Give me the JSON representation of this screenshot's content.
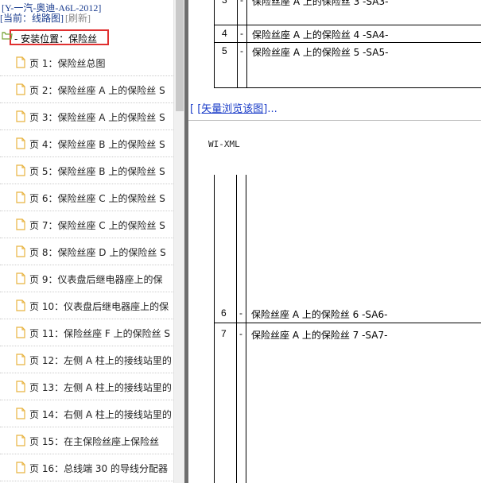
{
  "tree": {
    "vehicle_title": "[Y-一汽-奥迪-A6L-2012]",
    "breadcrumb_current": "[当前：线路图]",
    "breadcrumb_refresh": "[刷新]",
    "folder_label": "- 安装位置：保险丝",
    "items": [
      "页 1：保险丝总图",
      "页 2：保险丝座 A 上的保险丝 S",
      "页 3：保险丝座 A 上的保险丝 S",
      "页 4：保险丝座 B 上的保险丝 S",
      "页 5：保险丝座 B 上的保险丝 S",
      "页 6：保险丝座 C 上的保险丝 S",
      "页 7：保险丝座 C 上的保险丝 S",
      "页 8：保险丝座 D 上的保险丝 S",
      "页 9：仪表盘后继电器座上的保",
      "页 10：仪表盘后继电器座上的保",
      "页 11：保险丝座 F 上的保险丝 S",
      "页 12：左侧 A 柱上的接线站里的",
      "页 13：左侧 A 柱上的接线站里的",
      "页 14：右侧 A 柱上的接线站里的",
      "页 15：在主保险丝座上保险丝",
      "页 16：总线端 30 的导线分配器"
    ]
  },
  "doc": {
    "top_rows": [
      {
        "num": "3",
        "dash": "-",
        "desc": "保险丝座 A 上的保险丝 3 -SA3-"
      },
      {
        "num": "4",
        "dash": "-",
        "desc": "保险丝座 A 上的保险丝 4 -SA4-"
      },
      {
        "num": "5",
        "dash": "-",
        "desc": "保险丝座 A 上的保险丝 5 -SA5-"
      }
    ],
    "vector_link_open": "[",
    "vector_link": "[矢量浏览该图]",
    "vector_link_close": "...",
    "wi_label": "WI-XML",
    "bottom_rows": [
      {
        "num": "6",
        "dash": "-",
        "desc": "保险丝座 A 上的保险丝 6 -SA6-"
      },
      {
        "num": "7",
        "dash": "-",
        "desc": "保险丝座 A 上的保险丝 7 -SA7-"
      }
    ]
  },
  "icons": {
    "folder": "folder-open-icon",
    "page": "document-icon"
  },
  "colors": {
    "highlight_border": "#e03030",
    "link": "#1a3cc8",
    "title_text": "#1b3d8f",
    "splitter": "#6e6e6e",
    "doc_icon": "#e8b341"
  }
}
